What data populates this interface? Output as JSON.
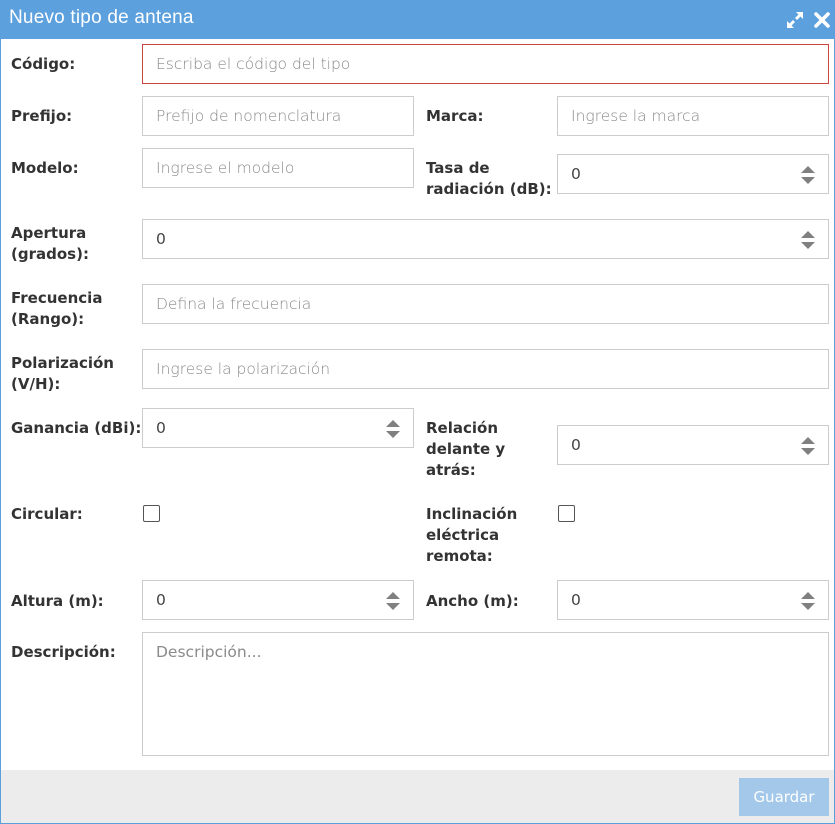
{
  "dialog": {
    "title": "Nuevo tipo de antena",
    "icons": {
      "maximize": "expand-arrows-icon",
      "close": "close-x-icon"
    },
    "colors": {
      "titlebar": "#5ca0de",
      "error_border": "#c9473c",
      "save_button": "#a3c8ea",
      "footer": "#ececec"
    }
  },
  "form": {
    "codigo": {
      "label": "Código:",
      "placeholder": "Escriba el código del tipo"
    },
    "prefijo": {
      "label": "Prefijo:",
      "placeholder": "Prefijo de nomenclatura"
    },
    "marca": {
      "label": "Marca:",
      "placeholder": "Ingrese la marca"
    },
    "modelo": {
      "label": "Modelo:",
      "placeholder": "Ingrese el modelo"
    },
    "tasa_radiacion": {
      "label_line1": "Tasa de",
      "label_line2": "radiación (dB):",
      "value": "0"
    },
    "apertura": {
      "label_line1": "Apertura",
      "label_line2": "(grados):",
      "value": "0"
    },
    "frecuencia": {
      "label_line1": "Frecuencia",
      "label_line2": "(Rango):",
      "placeholder": "Defina la frecuencia"
    },
    "polarizacion": {
      "label_line1": "Polarización",
      "label_line2": "(V/H):",
      "placeholder": "Ingrese la polarización"
    },
    "ganancia": {
      "label": "Ganancia (dBi):",
      "value": "0"
    },
    "relacion": {
      "label_line1": "Relación",
      "label_line2": "delante y",
      "label_line3": "atrás:",
      "value": "0"
    },
    "circular": {
      "label": "Circular:",
      "checked": false
    },
    "inclinacion": {
      "label_line1": "Inclinación",
      "label_line2": "eléctrica",
      "label_line3": "remota:",
      "checked": false
    },
    "altura": {
      "label": "Altura (m):",
      "value": "0"
    },
    "ancho": {
      "label": "Ancho (m):",
      "value": "0"
    },
    "descripcion": {
      "label": "Descripción:",
      "placeholder": "Descripción..."
    }
  },
  "footer": {
    "save_label": "Guardar"
  }
}
